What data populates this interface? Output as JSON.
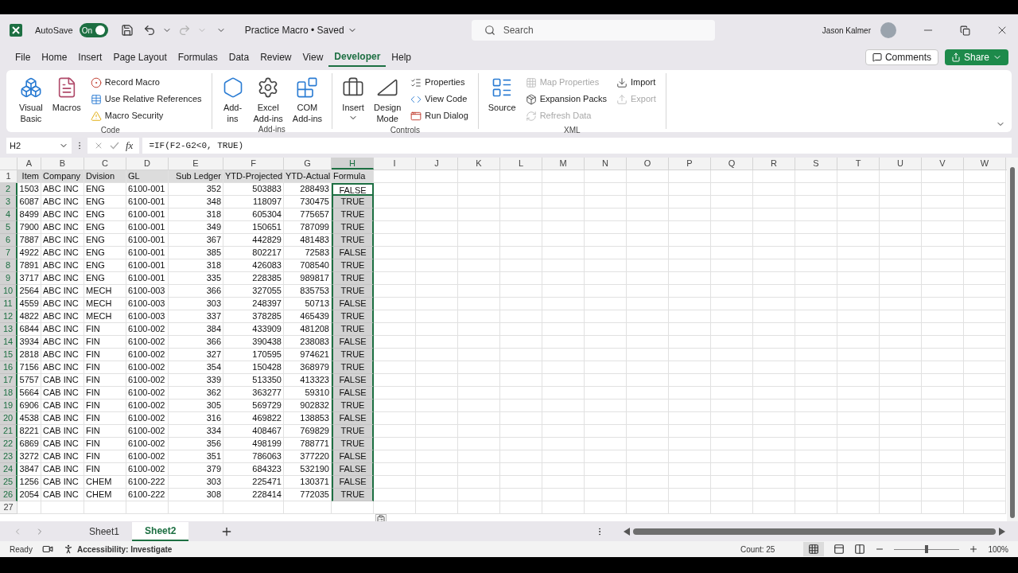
{
  "title_bar": {
    "autosave_label": "AutoSave",
    "autosave": {
      "label": "On",
      "on": true
    },
    "redo_disabled": true,
    "document_title": "Practice Macro • Saved",
    "search": {
      "placeholder": "Search"
    },
    "user_name": "Jason Kalmer"
  },
  "menu_tabs": [
    {
      "label": "File",
      "selected": false
    },
    {
      "label": "Home",
      "selected": false
    },
    {
      "label": "Insert",
      "selected": false
    },
    {
      "label": "Page Layout",
      "selected": false
    },
    {
      "label": "Formulas",
      "selected": false
    },
    {
      "label": "Data",
      "selected": false
    },
    {
      "label": "Review",
      "selected": false
    },
    {
      "label": "View",
      "selected": false
    },
    {
      "label": "Developer",
      "selected": true
    },
    {
      "label": "Help",
      "selected": false
    }
  ],
  "comments_button": "Comments",
  "share_button": "Share",
  "ribbon": {
    "groups": [
      {
        "label": "Code",
        "items": [
          {
            "kind": "large",
            "lines": [
              "Visual",
              "Basic"
            ],
            "disabled": false
          },
          {
            "kind": "large",
            "lines": [
              "Macros"
            ],
            "disabled": false
          },
          {
            "kind": "small",
            "lines": [
              "Record Macro"
            ],
            "disabled": false
          },
          {
            "kind": "small",
            "lines": [
              "Use Relative References"
            ],
            "disabled": false
          },
          {
            "kind": "small",
            "lines": [
              "Macro Security"
            ],
            "disabled": false
          }
        ]
      },
      {
        "label": "Add-ins",
        "items": [
          {
            "kind": "large",
            "lines": [
              "Add-",
              "ins"
            ],
            "disabled": false
          },
          {
            "kind": "large",
            "lines": [
              "Excel",
              "Add-ins"
            ],
            "disabled": false
          },
          {
            "kind": "large",
            "lines": [
              "COM",
              "Add-ins"
            ],
            "disabled": false
          }
        ]
      },
      {
        "label": "Controls",
        "items": [
          {
            "kind": "large",
            "lines": [
              "Insert"
            ],
            "disabled": false
          },
          {
            "kind": "large",
            "lines": [
              "Design",
              "Mode"
            ],
            "disabled": false
          },
          {
            "kind": "small",
            "lines": [
              "Properties"
            ],
            "disabled": false
          },
          {
            "kind": "small",
            "lines": [
              "View Code"
            ],
            "disabled": false
          },
          {
            "kind": "small",
            "lines": [
              "Run Dialog"
            ],
            "disabled": false
          }
        ]
      },
      {
        "label": "XML",
        "items": [
          {
            "kind": "large",
            "lines": [
              "Source"
            ],
            "disabled": false
          },
          {
            "kind": "small",
            "lines": [
              "Map Properties"
            ],
            "disabled": true
          },
          {
            "kind": "small",
            "lines": [
              "Expansion Packs"
            ],
            "disabled": false
          },
          {
            "kind": "small",
            "lines": [
              "Refresh Data"
            ],
            "disabled": true
          },
          {
            "kind": "small",
            "lines": [
              "Import"
            ],
            "disabled": false
          },
          {
            "kind": "small",
            "lines": [
              "Export"
            ],
            "disabled": true
          }
        ]
      }
    ]
  },
  "formula_bar": {
    "name_box": "H2",
    "function_label": "fx",
    "formula": "=IF(F2-G2<0, TRUE)"
  },
  "sheet": {
    "columns": [
      {
        "label": "A",
        "selected": false
      },
      {
        "label": "B",
        "selected": false
      },
      {
        "label": "C",
        "selected": false
      },
      {
        "label": "D",
        "selected": false
      },
      {
        "label": "E",
        "selected": false
      },
      {
        "label": "F",
        "selected": false
      },
      {
        "label": "G",
        "selected": false
      },
      {
        "label": "H",
        "selected": true
      },
      {
        "label": "I",
        "selected": false
      },
      {
        "label": "J",
        "selected": false
      },
      {
        "label": "K",
        "selected": false
      },
      {
        "label": "L",
        "selected": false
      },
      {
        "label": "M",
        "selected": false
      },
      {
        "label": "N",
        "selected": false
      },
      {
        "label": "O",
        "selected": false
      },
      {
        "label": "P",
        "selected": false
      },
      {
        "label": "Q",
        "selected": false
      },
      {
        "label": "R",
        "selected": false
      },
      {
        "label": "S",
        "selected": false
      },
      {
        "label": "T",
        "selected": false
      },
      {
        "label": "U",
        "selected": false
      },
      {
        "label": "V",
        "selected": false
      },
      {
        "label": "W",
        "selected": false
      }
    ],
    "rows": [
      {
        "number": "1",
        "kind": "header",
        "selected": false,
        "active": false,
        "cells": [
          "Item",
          "Company",
          "Dvision",
          "GL",
          "Sub Ledger",
          "YTD-Projected",
          "YTD-Actual",
          "Formula"
        ]
      },
      {
        "number": "2",
        "kind": "data",
        "selected": true,
        "active": true,
        "cells": [
          "1503",
          "ABC INC",
          "ENG",
          "6100-001",
          "352",
          "503883",
          "288493",
          "FALSE"
        ]
      },
      {
        "number": "3",
        "kind": "data",
        "selected": true,
        "active": false,
        "cells": [
          "6087",
          "ABC INC",
          "ENG",
          "6100-001",
          "348",
          "118097",
          "730475",
          "TRUE"
        ]
      },
      {
        "number": "4",
        "kind": "data",
        "selected": true,
        "active": false,
        "cells": [
          "8499",
          "ABC INC",
          "ENG",
          "6100-001",
          "318",
          "605304",
          "775657",
          "TRUE"
        ]
      },
      {
        "number": "5",
        "kind": "data",
        "selected": true,
        "active": false,
        "cells": [
          "7900",
          "ABC INC",
          "ENG",
          "6100-001",
          "349",
          "150651",
          "787099",
          "TRUE"
        ]
      },
      {
        "number": "6",
        "kind": "data",
        "selected": true,
        "active": false,
        "cells": [
          "7887",
          "ABC INC",
          "ENG",
          "6100-001",
          "367",
          "442829",
          "481483",
          "TRUE"
        ]
      },
      {
        "number": "7",
        "kind": "data",
        "selected": true,
        "active": false,
        "cells": [
          "4922",
          "ABC INC",
          "ENG",
          "6100-001",
          "385",
          "802217",
          "72583",
          "FALSE"
        ]
      },
      {
        "number": "8",
        "kind": "data",
        "selected": true,
        "active": false,
        "cells": [
          "7891",
          "ABC INC",
          "ENG",
          "6100-001",
          "318",
          "426083",
          "708540",
          "TRUE"
        ]
      },
      {
        "number": "9",
        "kind": "data",
        "selected": true,
        "active": false,
        "cells": [
          "3717",
          "ABC INC",
          "ENG",
          "6100-001",
          "335",
          "228385",
          "989817",
          "TRUE"
        ]
      },
      {
        "number": "10",
        "kind": "data",
        "selected": true,
        "active": false,
        "cells": [
          "2564",
          "ABC INC",
          "MECH",
          "6100-003",
          "366",
          "327055",
          "835753",
          "TRUE"
        ]
      },
      {
        "number": "11",
        "kind": "data",
        "selected": true,
        "active": false,
        "cells": [
          "4559",
          "ABC INC",
          "MECH",
          "6100-003",
          "303",
          "248397",
          "50713",
          "FALSE"
        ]
      },
      {
        "number": "12",
        "kind": "data",
        "selected": true,
        "active": false,
        "cells": [
          "4822",
          "ABC INC",
          "MECH",
          "6100-003",
          "337",
          "378285",
          "465439",
          "TRUE"
        ]
      },
      {
        "number": "13",
        "kind": "data",
        "selected": true,
        "active": false,
        "cells": [
          "6844",
          "ABC INC",
          "FIN",
          "6100-002",
          "384",
          "433909",
          "481208",
          "TRUE"
        ]
      },
      {
        "number": "14",
        "kind": "data",
        "selected": true,
        "active": false,
        "cells": [
          "3934",
          "ABC INC",
          "FIN",
          "6100-002",
          "366",
          "390438",
          "238083",
          "FALSE"
        ]
      },
      {
        "number": "15",
        "kind": "data",
        "selected": true,
        "active": false,
        "cells": [
          "2818",
          "ABC INC",
          "FIN",
          "6100-002",
          "327",
          "170595",
          "974621",
          "TRUE"
        ]
      },
      {
        "number": "16",
        "kind": "data",
        "selected": true,
        "active": false,
        "cells": [
          "7156",
          "ABC INC",
          "FIN",
          "6100-002",
          "354",
          "150428",
          "368979",
          "TRUE"
        ]
      },
      {
        "number": "17",
        "kind": "data",
        "selected": true,
        "active": false,
        "cells": [
          "5757",
          "CAB INC",
          "FIN",
          "6100-002",
          "339",
          "513350",
          "413323",
          "FALSE"
        ]
      },
      {
        "number": "18",
        "kind": "data",
        "selected": true,
        "active": false,
        "cells": [
          "5664",
          "CAB INC",
          "FIN",
          "6100-002",
          "362",
          "363277",
          "59310",
          "FALSE"
        ]
      },
      {
        "number": "19",
        "kind": "data",
        "selected": true,
        "active": false,
        "cells": [
          "6906",
          "CAB INC",
          "FIN",
          "6100-002",
          "305",
          "569729",
          "902832",
          "TRUE"
        ]
      },
      {
        "number": "20",
        "kind": "data",
        "selected": true,
        "active": false,
        "cells": [
          "4538",
          "CAB INC",
          "FIN",
          "6100-002",
          "316",
          "469822",
          "138853",
          "FALSE"
        ]
      },
      {
        "number": "21",
        "kind": "data",
        "selected": true,
        "active": false,
        "cells": [
          "8221",
          "CAB INC",
          "FIN",
          "6100-002",
          "334",
          "408467",
          "769829",
          "TRUE"
        ]
      },
      {
        "number": "22",
        "kind": "data",
        "selected": true,
        "active": false,
        "cells": [
          "6869",
          "CAB INC",
          "FIN",
          "6100-002",
          "356",
          "498199",
          "788771",
          "TRUE"
        ]
      },
      {
        "number": "23",
        "kind": "data",
        "selected": true,
        "active": false,
        "cells": [
          "3272",
          "CAB INC",
          "FIN",
          "6100-002",
          "351",
          "786063",
          "377220",
          "FALSE"
        ]
      },
      {
        "number": "24",
        "kind": "data",
        "selected": true,
        "active": false,
        "cells": [
          "3847",
          "CAB INC",
          "FIN",
          "6100-002",
          "379",
          "684323",
          "532190",
          "FALSE"
        ]
      },
      {
        "number": "25",
        "kind": "data",
        "selected": true,
        "active": false,
        "cells": [
          "1256",
          "CAB INC",
          "CHEM",
          "6100-222",
          "303",
          "225471",
          "130371",
          "FALSE"
        ]
      },
      {
        "number": "26",
        "kind": "data",
        "selected": true,
        "active": false,
        "cells": [
          "2054",
          "CAB INC",
          "CHEM",
          "6100-222",
          "308",
          "228414",
          "772035",
          "TRUE"
        ]
      },
      {
        "number": "27",
        "kind": "data",
        "selected": false,
        "active": false
      }
    ]
  },
  "sheet_tabs": [
    {
      "label": "Sheet1",
      "selected": false
    },
    {
      "label": "Sheet2",
      "selected": true
    }
  ],
  "status_bar": {
    "mode": "Ready",
    "accessibility": "Accessibility: Investigate",
    "count": "Count: 25",
    "zoom": {
      "level": 0.5,
      "reading": "100%"
    }
  }
}
